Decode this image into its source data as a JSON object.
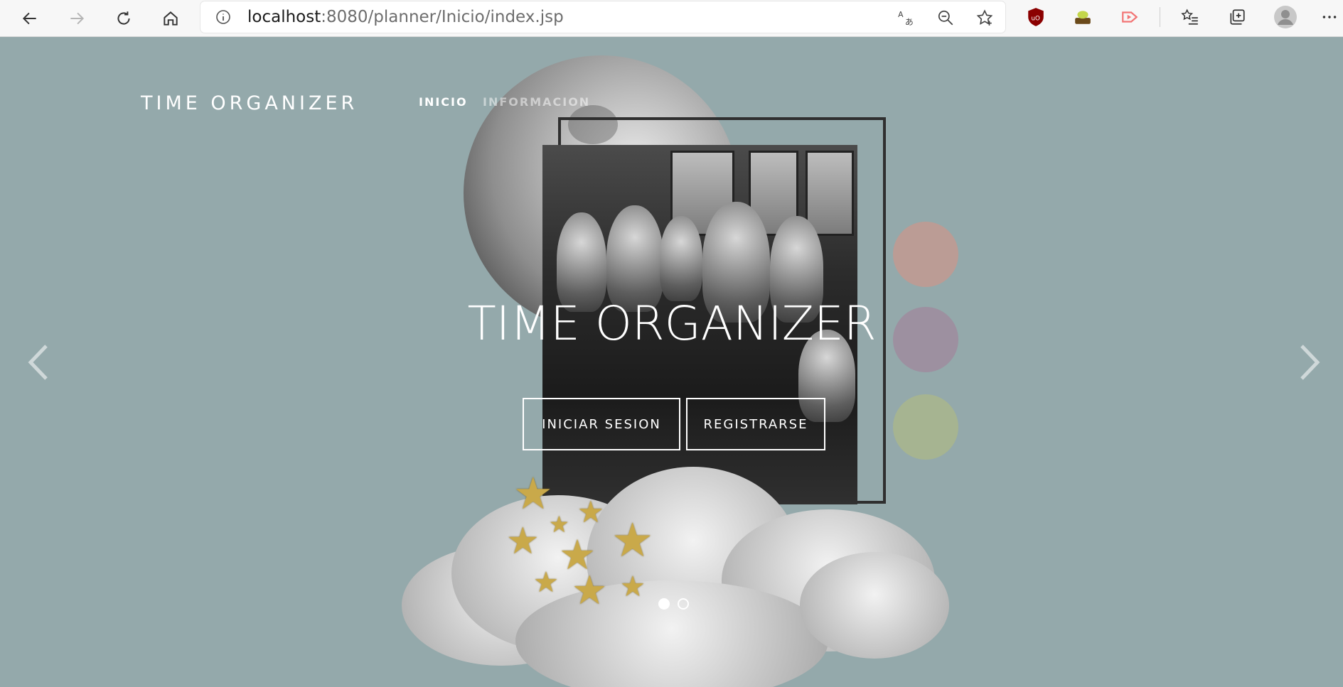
{
  "browser": {
    "url_host": "localhost",
    "url_rest": ":8080/planner/Inicio/index.jsp",
    "icons": [
      "back-icon",
      "forward-icon",
      "refresh-icon",
      "home-icon",
      "info-icon",
      "translate-icon",
      "zoom-out-icon",
      "favorite-star-icon",
      "ublock-icon",
      "extension-icon",
      "video-extension-icon",
      "favorites-list-icon",
      "collections-icon",
      "profile-avatar-icon",
      "more-icon"
    ]
  },
  "page": {
    "brand": "TIME ORGANIZER",
    "nav": [
      {
        "label": "INICIO",
        "active": true
      },
      {
        "label": "INFORMACION",
        "active": false
      }
    ],
    "hero": {
      "title": "TIME ORGANIZER",
      "login_button": "INICIAR SESION",
      "register_button": "REGISTRARSE"
    },
    "carousel": {
      "slides": 2,
      "active_slide": 1
    }
  },
  "colors": {
    "background": "#94a9ab",
    "circle_pink": "#c29a91",
    "circle_purple": "#9d8d9e",
    "circle_green": "#a7b58e",
    "star_gold": "#c9a94a"
  }
}
